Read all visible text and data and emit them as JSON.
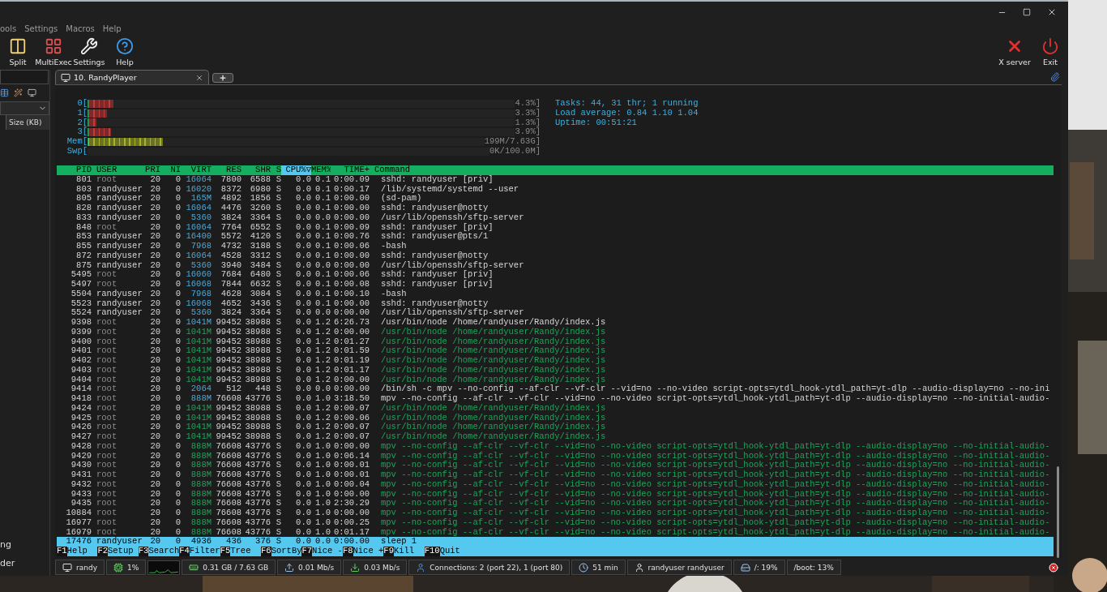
{
  "menu": [
    "ools",
    "Settings",
    "Macros",
    "Help"
  ],
  "toolbar": {
    "left": [
      {
        "kind": "split",
        "label": "Split"
      },
      {
        "kind": "multiexec",
        "label": "MultiExec"
      },
      {
        "kind": "settings",
        "label": "Settings"
      },
      {
        "kind": "help",
        "label": "Help"
      }
    ],
    "right": [
      {
        "kind": "xserver",
        "label": "X server"
      },
      {
        "kind": "exit",
        "label": "Exit"
      }
    ]
  },
  "sidebar": {
    "column_header": "Size (KB)",
    "texts": [
      "ng",
      "der"
    ]
  },
  "tabs": [
    {
      "label": "10. RandyPlayer",
      "selected": true
    }
  ],
  "htop": {
    "meters": [
      {
        "kind": "cpu",
        "label": "0[",
        "level": 0.06,
        "reading": "4.3%]"
      },
      {
        "kind": "cpu",
        "label": "1[",
        "level": 0.045,
        "reading": "3.3%]"
      },
      {
        "kind": "cpu",
        "label": "2[",
        "level": 0.02,
        "reading": "1.3%]"
      },
      {
        "kind": "cpu",
        "label": "3[",
        "level": 0.055,
        "reading": "3.9%]"
      },
      {
        "kind": "memory",
        "label": "Mem[",
        "level": 0.19,
        "reading": "199M/7.63G]"
      },
      {
        "kind": "swap",
        "label": "Swp[",
        "level": 0,
        "reading": "0K/100.0M]"
      }
    ],
    "info": [
      "Tasks: 44, 31 thr; 1 running",
      "Load average: 0.84 1.10 1.04",
      "Uptime: 00:51:21"
    ],
    "columns": [
      {
        "label": "PID",
        "sorted": false
      },
      {
        "label": "USER",
        "sorted": false
      },
      {
        "label": "PRI",
        "sorted": false
      },
      {
        "label": "NI",
        "sorted": false
      },
      {
        "label": "VIRT",
        "sorted": false
      },
      {
        "label": "RES",
        "sorted": false
      },
      {
        "label": "SHR",
        "sorted": false
      },
      {
        "label": "S",
        "sorted": false
      },
      {
        "label": "CPU%▽",
        "sorted": true
      },
      {
        "label": "MEM%",
        "sorted": false
      },
      {
        "label": "TIME+",
        "sorted": false
      },
      {
        "label": "Command",
        "sorted": false
      }
    ],
    "processes": [
      {
        "pid": "801",
        "user": "root",
        "pri": "20",
        "ni": "0",
        "virt": "16064",
        "res": "7800",
        "shr": "6588",
        "s": "S",
        "cpu": "0.0",
        "mem": "0.1",
        "time": "0:00.09",
        "command": "sshd: randyuser [priv]",
        "dim": true,
        "thread": false,
        "selected": false
      },
      {
        "pid": "803",
        "user": "randyuser",
        "pri": "20",
        "ni": "0",
        "virt": "16020",
        "res": "8372",
        "shr": "6980",
        "s": "S",
        "cpu": "0.0",
        "mem": "0.1",
        "time": "0:00.17",
        "command": "/lib/systemd/systemd --user",
        "dim": false,
        "thread": false,
        "selected": false
      },
      {
        "pid": "805",
        "user": "randyuser",
        "pri": "20",
        "ni": "0",
        "virt": "165M",
        "res": "4892",
        "shr": "1856",
        "s": "S",
        "cpu": "0.0",
        "mem": "0.1",
        "time": "0:00.00",
        "command": "(sd-pam)",
        "dim": false,
        "thread": false,
        "selected": false
      },
      {
        "pid": "828",
        "user": "randyuser",
        "pri": "20",
        "ni": "0",
        "virt": "16064",
        "res": "4476",
        "shr": "3260",
        "s": "S",
        "cpu": "0.0",
        "mem": "0.1",
        "time": "0:00.00",
        "command": "sshd: randyuser@notty",
        "dim": false,
        "thread": false,
        "selected": false
      },
      {
        "pid": "833",
        "user": "randyuser",
        "pri": "20",
        "ni": "0",
        "virt": "5360",
        "res": "3824",
        "shr": "3364",
        "s": "S",
        "cpu": "0.0",
        "mem": "0.0",
        "time": "0:00.00",
        "command": "/usr/lib/openssh/sftp-server",
        "dim": false,
        "thread": false,
        "selected": false
      },
      {
        "pid": "848",
        "user": "root",
        "pri": "20",
        "ni": "0",
        "virt": "16064",
        "res": "7764",
        "shr": "6552",
        "s": "S",
        "cpu": "0.0",
        "mem": "0.1",
        "time": "0:00.09",
        "command": "sshd: randyuser [priv]",
        "dim": true,
        "thread": false,
        "selected": false
      },
      {
        "pid": "853",
        "user": "randyuser",
        "pri": "20",
        "ni": "0",
        "virt": "16400",
        "res": "5572",
        "shr": "4120",
        "s": "S",
        "cpu": "0.0",
        "mem": "0.1",
        "time": "0:00.76",
        "command": "sshd: randyuser@pts/1",
        "dim": false,
        "thread": false,
        "selected": false
      },
      {
        "pid": "855",
        "user": "randyuser",
        "pri": "20",
        "ni": "0",
        "virt": "7968",
        "res": "4732",
        "shr": "3188",
        "s": "S",
        "cpu": "0.0",
        "mem": "0.1",
        "time": "0:00.06",
        "command": "-bash",
        "dim": false,
        "thread": false,
        "selected": false
      },
      {
        "pid": "872",
        "user": "randyuser",
        "pri": "20",
        "ni": "0",
        "virt": "16064",
        "res": "4528",
        "shr": "3312",
        "s": "S",
        "cpu": "0.0",
        "mem": "0.1",
        "time": "0:00.00",
        "command": "sshd: randyuser@notty",
        "dim": false,
        "thread": false,
        "selected": false
      },
      {
        "pid": "875",
        "user": "randyuser",
        "pri": "20",
        "ni": "0",
        "virt": "5360",
        "res": "3940",
        "shr": "3484",
        "s": "S",
        "cpu": "0.0",
        "mem": "0.0",
        "time": "0:00.00",
        "command": "/usr/lib/openssh/sftp-server",
        "dim": false,
        "thread": false,
        "selected": false
      },
      {
        "pid": "5495",
        "user": "root",
        "pri": "20",
        "ni": "0",
        "virt": "16060",
        "res": "7684",
        "shr": "6480",
        "s": "S",
        "cpu": "0.0",
        "mem": "0.1",
        "time": "0:00.06",
        "command": "sshd: randyuser [priv]",
        "dim": true,
        "thread": false,
        "selected": false
      },
      {
        "pid": "5497",
        "user": "root",
        "pri": "20",
        "ni": "0",
        "virt": "16068",
        "res": "7844",
        "shr": "6632",
        "s": "S",
        "cpu": "0.0",
        "mem": "0.1",
        "time": "0:00.08",
        "command": "sshd: randyuser [priv]",
        "dim": true,
        "thread": false,
        "selected": false
      },
      {
        "pid": "5504",
        "user": "randyuser",
        "pri": "20",
        "ni": "0",
        "virt": "7968",
        "res": "4628",
        "shr": "3084",
        "s": "S",
        "cpu": "0.0",
        "mem": "0.1",
        "time": "0:00.10",
        "command": "-bash",
        "dim": false,
        "thread": false,
        "selected": false
      },
      {
        "pid": "5523",
        "user": "randyuser",
        "pri": "20",
        "ni": "0",
        "virt": "16068",
        "res": "4652",
        "shr": "3436",
        "s": "S",
        "cpu": "0.0",
        "mem": "0.1",
        "time": "0:00.00",
        "command": "sshd: randyuser@notty",
        "dim": false,
        "thread": false,
        "selected": false
      },
      {
        "pid": "5524",
        "user": "randyuser",
        "pri": "20",
        "ni": "0",
        "virt": "5360",
        "res": "3824",
        "shr": "3364",
        "s": "S",
        "cpu": "0.0",
        "mem": "0.0",
        "time": "0:00.00",
        "command": "/usr/lib/openssh/sftp-server",
        "dim": false,
        "thread": false,
        "selected": false
      },
      {
        "pid": "9398",
        "user": "root",
        "pri": "20",
        "ni": "0",
        "virt": "1041M",
        "res": "99452",
        "shr": "38988",
        "s": "S",
        "cpu": "0.0",
        "mem": "1.2",
        "time": "6:26.73",
        "command": "/usr/bin/node /home/randyuser/Randy/index.js",
        "dim": true,
        "thread": false,
        "selected": false
      },
      {
        "pid": "9399",
        "user": "root",
        "pri": "20",
        "ni": "0",
        "virt": "1041M",
        "res": "99452",
        "shr": "38988",
        "s": "S",
        "cpu": "0.0",
        "mem": "1.2",
        "time": "0:00.00",
        "command": "/usr/bin/node /home/randyuser/Randy/index.js",
        "dim": true,
        "thread": true,
        "selected": false
      },
      {
        "pid": "9400",
        "user": "root",
        "pri": "20",
        "ni": "0",
        "virt": "1041M",
        "res": "99452",
        "shr": "38988",
        "s": "S",
        "cpu": "0.0",
        "mem": "1.2",
        "time": "0:01.27",
        "command": "/usr/bin/node /home/randyuser/Randy/index.js",
        "dim": true,
        "thread": true,
        "selected": false
      },
      {
        "pid": "9401",
        "user": "root",
        "pri": "20",
        "ni": "0",
        "virt": "1041M",
        "res": "99452",
        "shr": "38988",
        "s": "S",
        "cpu": "0.0",
        "mem": "1.2",
        "time": "0:01.59",
        "command": "/usr/bin/node /home/randyuser/Randy/index.js",
        "dim": true,
        "thread": true,
        "selected": false
      },
      {
        "pid": "9402",
        "user": "root",
        "pri": "20",
        "ni": "0",
        "virt": "1041M",
        "res": "99452",
        "shr": "38988",
        "s": "S",
        "cpu": "0.0",
        "mem": "1.2",
        "time": "0:01.19",
        "command": "/usr/bin/node /home/randyuser/Randy/index.js",
        "dim": true,
        "thread": true,
        "selected": false
      },
      {
        "pid": "9403",
        "user": "root",
        "pri": "20",
        "ni": "0",
        "virt": "1041M",
        "res": "99452",
        "shr": "38988",
        "s": "S",
        "cpu": "0.0",
        "mem": "1.2",
        "time": "0:01.17",
        "command": "/usr/bin/node /home/randyuser/Randy/index.js",
        "dim": true,
        "thread": true,
        "selected": false
      },
      {
        "pid": "9404",
        "user": "root",
        "pri": "20",
        "ni": "0",
        "virt": "1041M",
        "res": "99452",
        "shr": "38988",
        "s": "S",
        "cpu": "0.0",
        "mem": "1.2",
        "time": "0:00.00",
        "command": "/usr/bin/node /home/randyuser/Randy/index.js",
        "dim": true,
        "thread": true,
        "selected": false
      },
      {
        "pid": "9414",
        "user": "root",
        "pri": "20",
        "ni": "0",
        "virt": "2064",
        "res": "512",
        "shr": "448",
        "s": "S",
        "cpu": "0.0",
        "mem": "0.0",
        "time": "0:00.00",
        "command": "/bin/sh -c mpv --no-config --af-clr --vf-clr --vid=no --no-video script-opts=ytdl_hook-ytdl_path=yt-dlp --audio-display=no --no-ini",
        "dim": true,
        "thread": false,
        "selected": false
      },
      {
        "pid": "9418",
        "user": "root",
        "pri": "20",
        "ni": "0",
        "virt": "888M",
        "res": "76608",
        "shr": "43776",
        "s": "S",
        "cpu": "0.0",
        "mem": "1.0",
        "time": "3:18.50",
        "command": "mpv --no-config --af-clr --vf-clr --vid=no --no-video script-opts=ytdl_hook-ytdl_path=yt-dlp --audio-display=no --no-initial-audio-",
        "dim": true,
        "thread": false,
        "selected": false
      },
      {
        "pid": "9424",
        "user": "root",
        "pri": "20",
        "ni": "0",
        "virt": "1041M",
        "res": "99452",
        "shr": "38988",
        "s": "S",
        "cpu": "0.0",
        "mem": "1.2",
        "time": "0:00.07",
        "command": "/usr/bin/node /home/randyuser/Randy/index.js",
        "dim": true,
        "thread": true,
        "selected": false
      },
      {
        "pid": "9425",
        "user": "root",
        "pri": "20",
        "ni": "0",
        "virt": "1041M",
        "res": "99452",
        "shr": "38988",
        "s": "S",
        "cpu": "0.0",
        "mem": "1.2",
        "time": "0:00.06",
        "command": "/usr/bin/node /home/randyuser/Randy/index.js",
        "dim": true,
        "thread": true,
        "selected": false
      },
      {
        "pid": "9426",
        "user": "root",
        "pri": "20",
        "ni": "0",
        "virt": "1041M",
        "res": "99452",
        "shr": "38988",
        "s": "S",
        "cpu": "0.0",
        "mem": "1.2",
        "time": "0:00.07",
        "command": "/usr/bin/node /home/randyuser/Randy/index.js",
        "dim": true,
        "thread": true,
        "selected": false
      },
      {
        "pid": "9427",
        "user": "root",
        "pri": "20",
        "ni": "0",
        "virt": "1041M",
        "res": "99452",
        "shr": "38988",
        "s": "S",
        "cpu": "0.0",
        "mem": "1.2",
        "time": "0:00.07",
        "command": "/usr/bin/node /home/randyuser/Randy/index.js",
        "dim": true,
        "thread": true,
        "selected": false
      },
      {
        "pid": "9428",
        "user": "root",
        "pri": "20",
        "ni": "0",
        "virt": "888M",
        "res": "76608",
        "shr": "43776",
        "s": "S",
        "cpu": "0.0",
        "mem": "1.0",
        "time": "0:00.00",
        "command": "mpv --no-config --af-clr --vf-clr --vid=no --no-video script-opts=ytdl_hook-ytdl_path=yt-dlp --audio-display=no --no-initial-audio-",
        "dim": true,
        "thread": true,
        "selected": false
      },
      {
        "pid": "9429",
        "user": "root",
        "pri": "20",
        "ni": "0",
        "virt": "888M",
        "res": "76608",
        "shr": "43776",
        "s": "S",
        "cpu": "0.0",
        "mem": "1.0",
        "time": "0:06.14",
        "command": "mpv --no-config --af-clr --vf-clr --vid=no --no-video script-opts=ytdl_hook-ytdl_path=yt-dlp --audio-display=no --no-initial-audio-",
        "dim": true,
        "thread": true,
        "selected": false
      },
      {
        "pid": "9430",
        "user": "root",
        "pri": "20",
        "ni": "0",
        "virt": "888M",
        "res": "76608",
        "shr": "43776",
        "s": "S",
        "cpu": "0.0",
        "mem": "1.0",
        "time": "0:00.01",
        "command": "mpv --no-config --af-clr --vf-clr --vid=no --no-video script-opts=ytdl_hook-ytdl_path=yt-dlp --audio-display=no --no-initial-audio-",
        "dim": true,
        "thread": true,
        "selected": false
      },
      {
        "pid": "9431",
        "user": "root",
        "pri": "20",
        "ni": "0",
        "virt": "888M",
        "res": "76608",
        "shr": "43776",
        "s": "S",
        "cpu": "0.0",
        "mem": "1.0",
        "time": "0:00.01",
        "command": "mpv --no-config --af-clr --vf-clr --vid=no --no-video script-opts=ytdl_hook-ytdl_path=yt-dlp --audio-display=no --no-initial-audio-",
        "dim": true,
        "thread": true,
        "selected": false
      },
      {
        "pid": "9432",
        "user": "root",
        "pri": "20",
        "ni": "0",
        "virt": "888M",
        "res": "76608",
        "shr": "43776",
        "s": "S",
        "cpu": "0.0",
        "mem": "1.0",
        "time": "0:00.04",
        "command": "mpv --no-config --af-clr --vf-clr --vid=no --no-video script-opts=ytdl_hook-ytdl_path=yt-dlp --audio-display=no --no-initial-audio-",
        "dim": true,
        "thread": true,
        "selected": false
      },
      {
        "pid": "9433",
        "user": "root",
        "pri": "20",
        "ni": "0",
        "virt": "888M",
        "res": "76608",
        "shr": "43776",
        "s": "S",
        "cpu": "0.0",
        "mem": "1.0",
        "time": "0:00.00",
        "command": "mpv --no-config --af-clr --vf-clr --vid=no --no-video script-opts=ytdl_hook-ytdl_path=yt-dlp --audio-display=no --no-initial-audio-",
        "dim": true,
        "thread": true,
        "selected": false
      },
      {
        "pid": "9435",
        "user": "root",
        "pri": "20",
        "ni": "0",
        "virt": "888M",
        "res": "76608",
        "shr": "43776",
        "s": "S",
        "cpu": "0.0",
        "mem": "1.0",
        "time": "2:30.29",
        "command": "mpv --no-config --af-clr --vf-clr --vid=no --no-video script-opts=ytdl_hook-ytdl_path=yt-dlp --audio-display=no --no-initial-audio-",
        "dim": true,
        "thread": true,
        "selected": false
      },
      {
        "pid": "10884",
        "user": "root",
        "pri": "20",
        "ni": "0",
        "virt": "888M",
        "res": "76608",
        "shr": "43776",
        "s": "S",
        "cpu": "0.0",
        "mem": "1.0",
        "time": "0:00.00",
        "command": "mpv --no-config --af-clr --vf-clr --vid=no --no-video script-opts=ytdl_hook-ytdl_path=yt-dlp --audio-display=no --no-initial-audio-",
        "dim": true,
        "thread": true,
        "selected": false
      },
      {
        "pid": "16977",
        "user": "root",
        "pri": "20",
        "ni": "0",
        "virt": "888M",
        "res": "76608",
        "shr": "43776",
        "s": "S",
        "cpu": "0.0",
        "mem": "1.0",
        "time": "0:00.25",
        "command": "mpv --no-config --af-clr --vf-clr --vid=no --no-video script-opts=ytdl_hook-ytdl_path=yt-dlp --audio-display=no --no-initial-audio-",
        "dim": true,
        "thread": true,
        "selected": false
      },
      {
        "pid": "16979",
        "user": "root",
        "pri": "20",
        "ni": "0",
        "virt": "888M",
        "res": "76608",
        "shr": "43776",
        "s": "S",
        "cpu": "0.0",
        "mem": "1.0",
        "time": "0:01.17",
        "command": "mpv --no-config --af-clr --vf-clr --vid=no --no-video script-opts=ytdl_hook-ytdl_path=yt-dlp --audio-display=no --no-initial-audio-",
        "dim": true,
        "thread": true,
        "selected": false
      },
      {
        "pid": "17476",
        "user": "randyuser",
        "pri": "20",
        "ni": "0",
        "virt": "4936",
        "res": "436",
        "shr": "376",
        "s": "S",
        "cpu": "0.0",
        "mem": "0.0",
        "time": "0:00.00",
        "command": "sleep 1",
        "dim": false,
        "thread": false,
        "selected": true
      }
    ],
    "function_keys": [
      {
        "key": "F1",
        "label": "Help"
      },
      {
        "key": "F2",
        "label": "Setup"
      },
      {
        "key": "F3",
        "label": "Search"
      },
      {
        "key": "F4",
        "label": "Filter"
      },
      {
        "key": "F5",
        "label": "Tree"
      },
      {
        "key": "F6",
        "label": "SortBy"
      },
      {
        "key": "F7",
        "label": "Nice -"
      },
      {
        "key": "F8",
        "label": "Nice +"
      },
      {
        "key": "F9",
        "label": "Kill"
      },
      {
        "key": "F10",
        "label": "Quit"
      }
    ]
  },
  "status_bar": [
    {
      "kind": "session",
      "text": "randy"
    },
    {
      "kind": "cpu",
      "text": "1%"
    },
    {
      "kind": "memory",
      "text": "0.31 GB / 7.63 GB"
    },
    {
      "kind": "upload",
      "text": "0.01 Mb/s"
    },
    {
      "kind": "download",
      "text": "0.03 Mb/s"
    },
    {
      "kind": "connections",
      "text": "Connections: 2 (port 22), 1 (port 80)"
    },
    {
      "kind": "uptime",
      "text": "51 min"
    },
    {
      "kind": "users",
      "text": "randyuser  randyuser"
    },
    {
      "kind": "disk",
      "text": "/: 19%"
    },
    {
      "kind": "boot",
      "text": "/boot: 13%"
    }
  ]
}
